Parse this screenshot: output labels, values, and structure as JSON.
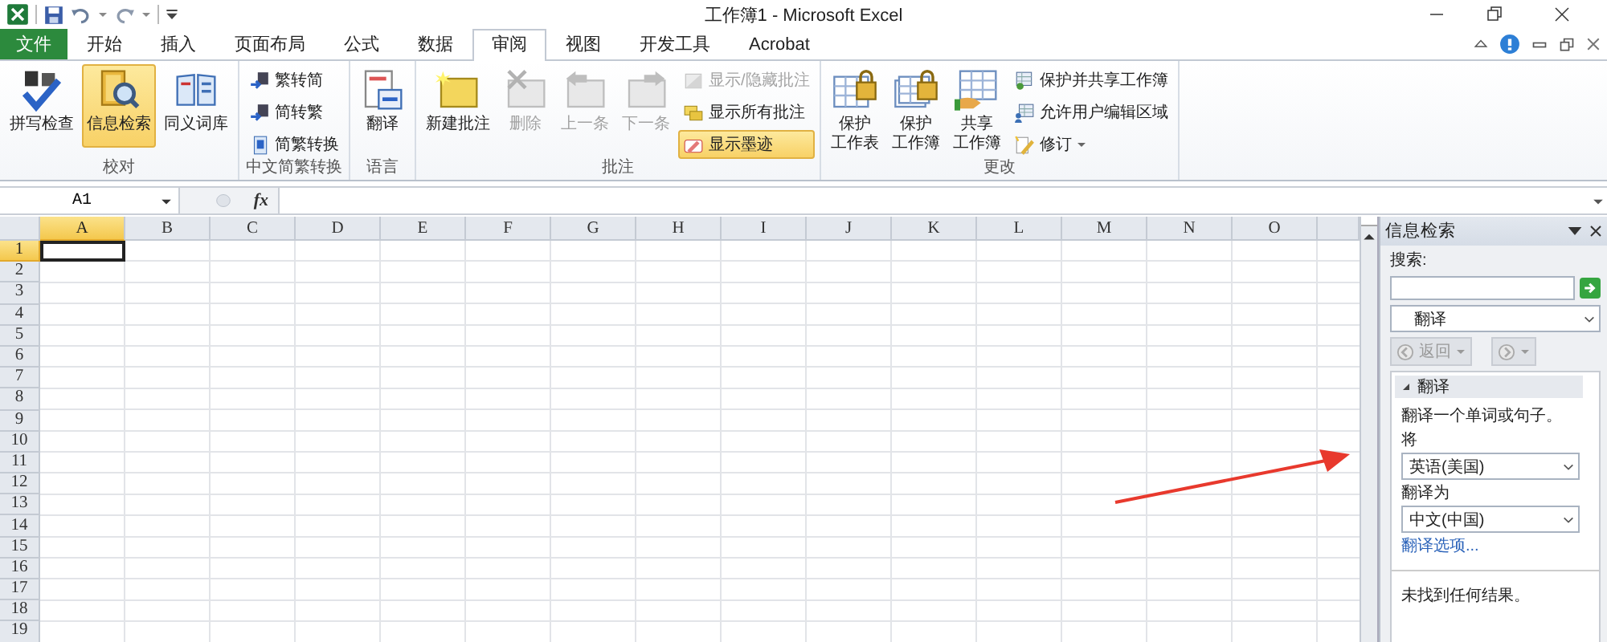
{
  "window": {
    "title": "工作簿1 - Microsoft Excel"
  },
  "tabs": [
    {
      "label": "文件",
      "kind": "file",
      "selected": false
    },
    {
      "label": "开始",
      "kind": "tab",
      "selected": false
    },
    {
      "label": "插入",
      "kind": "tab",
      "selected": false
    },
    {
      "label": "页面布局",
      "kind": "tab",
      "selected": false
    },
    {
      "label": "公式",
      "kind": "tab",
      "selected": false
    },
    {
      "label": "数据",
      "kind": "tab",
      "selected": false
    },
    {
      "label": "审阅",
      "kind": "tab",
      "selected": true
    },
    {
      "label": "视图",
      "kind": "tab",
      "selected": false
    },
    {
      "label": "开发工具",
      "kind": "tab",
      "selected": false
    },
    {
      "label": "Acrobat",
      "kind": "tab",
      "selected": false
    }
  ],
  "ribbon_groups": [
    {
      "title": "校对",
      "items": [
        {
          "label": "拼写检查",
          "kind": "large",
          "selected": false,
          "disabled": false
        },
        {
          "label": "信息检索",
          "kind": "large",
          "selected": true,
          "disabled": false
        },
        {
          "label": "同义词库",
          "kind": "large",
          "selected": false,
          "disabled": false
        }
      ]
    },
    {
      "title": "中文简繁转换",
      "items": [
        {
          "label": "繁转简",
          "kind": "small",
          "selected": false,
          "disabled": false
        },
        {
          "label": "简转繁",
          "kind": "small",
          "selected": false,
          "disabled": false
        },
        {
          "label": "简繁转换",
          "kind": "small",
          "selected": false,
          "disabled": false
        }
      ]
    },
    {
      "title": "语言",
      "items": [
        {
          "label": "翻译",
          "kind": "large",
          "selected": false,
          "disabled": false
        }
      ]
    },
    {
      "title": "批注",
      "items": [
        {
          "label": "新建批注",
          "kind": "large",
          "selected": false,
          "disabled": false
        },
        {
          "label": "删除",
          "kind": "large",
          "selected": false,
          "disabled": true
        },
        {
          "label": "上一条",
          "kind": "large",
          "selected": false,
          "disabled": true
        },
        {
          "label": "下一条",
          "kind": "large",
          "selected": false,
          "disabled": true
        },
        {
          "label": "显示/隐藏批注",
          "kind": "small",
          "selected": false,
          "disabled": true
        },
        {
          "label": "显示所有批注",
          "kind": "small",
          "selected": false,
          "disabled": false
        },
        {
          "label": "显示墨迹",
          "kind": "small",
          "selected": true,
          "disabled": false
        }
      ]
    },
    {
      "title": "更改",
      "items": [
        {
          "label_lines": [
            "保护",
            "工作表"
          ],
          "kind": "large",
          "selected": false,
          "disabled": false
        },
        {
          "label_lines": [
            "保护",
            "工作簿"
          ],
          "kind": "large",
          "selected": false,
          "disabled": false
        },
        {
          "label_lines": [
            "共享",
            "工作簿"
          ],
          "kind": "large",
          "selected": false,
          "disabled": false
        },
        {
          "label": "保护并共享工作簿",
          "kind": "small",
          "selected": false,
          "disabled": false
        },
        {
          "label": "允许用户编辑区域",
          "kind": "small",
          "selected": false,
          "disabled": false
        },
        {
          "label": "修订",
          "kind": "small",
          "selected": false,
          "disabled": false,
          "has_menu": true
        }
      ]
    }
  ],
  "formula_bar": {
    "name_box": "A1",
    "function_label": "fx"
  },
  "sheet": {
    "columns": [
      {
        "label": "A",
        "selected": true
      },
      {
        "label": "B",
        "selected": false
      },
      {
        "label": "C",
        "selected": false
      },
      {
        "label": "D",
        "selected": false
      },
      {
        "label": "E",
        "selected": false
      },
      {
        "label": "F",
        "selected": false
      },
      {
        "label": "G",
        "selected": false
      },
      {
        "label": "H",
        "selected": false
      },
      {
        "label": "I",
        "selected": false
      },
      {
        "label": "J",
        "selected": false
      },
      {
        "label": "K",
        "selected": false
      },
      {
        "label": "L",
        "selected": false
      },
      {
        "label": "M",
        "selected": false
      },
      {
        "label": "N",
        "selected": false
      },
      {
        "label": "O",
        "selected": false
      }
    ],
    "rows": [
      {
        "label": "1",
        "selected": true
      },
      {
        "label": "2",
        "selected": false
      },
      {
        "label": "3",
        "selected": false
      },
      {
        "label": "4",
        "selected": false
      },
      {
        "label": "5",
        "selected": false
      },
      {
        "label": "6",
        "selected": false
      },
      {
        "label": "7",
        "selected": false
      },
      {
        "label": "8",
        "selected": false
      },
      {
        "label": "9",
        "selected": false
      },
      {
        "label": "10",
        "selected": false
      },
      {
        "label": "11",
        "selected": false
      },
      {
        "label": "12",
        "selected": false
      },
      {
        "label": "13",
        "selected": false
      },
      {
        "label": "14",
        "selected": false
      },
      {
        "label": "15",
        "selected": false
      },
      {
        "label": "16",
        "selected": false
      },
      {
        "label": "17",
        "selected": false
      },
      {
        "label": "18",
        "selected": false
      },
      {
        "label": "19",
        "selected": false
      }
    ]
  },
  "task_pane": {
    "title": "信息检索",
    "search_label": "搜索:",
    "source": "翻译",
    "back": {
      "label": "返回",
      "disabled": true
    },
    "forward": {
      "disabled": true
    },
    "section": {
      "title": "翻译",
      "expanded": true,
      "description": "翻译一个单词或句子。",
      "from_label": "将",
      "from_value": "英语(美国)",
      "to_label": "翻译为",
      "to_value": "中文(中国)",
      "options_link": "翻译选项..."
    },
    "status": "未找到任何结果。"
  }
}
